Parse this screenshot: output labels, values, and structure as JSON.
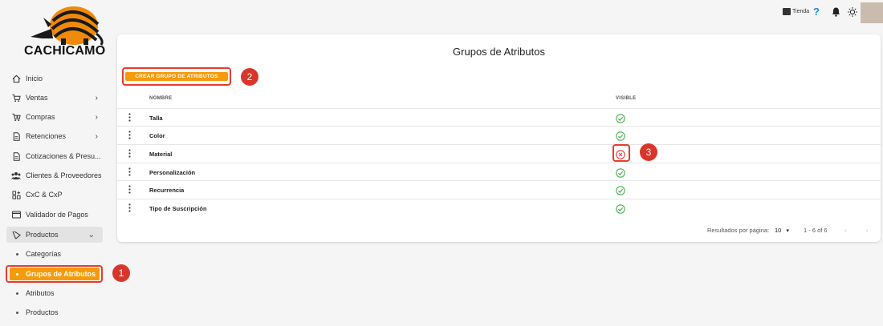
{
  "brand": {
    "name": "CACHICAMO"
  },
  "sidebar": {
    "items": [
      {
        "label": "Inicio",
        "icon": "home-icon"
      },
      {
        "label": "Ventas",
        "icon": "cart-icon"
      },
      {
        "label": "Compras",
        "icon": "cart-add-icon"
      },
      {
        "label": "Retenciones",
        "icon": "document-icon"
      },
      {
        "label": "Cotizaciones & Presu...",
        "icon": "document-icon"
      },
      {
        "label": "Clientes & Proveedores",
        "icon": "users-icon"
      },
      {
        "label": "CxC & CxP",
        "icon": "ledger-icon"
      },
      {
        "label": "Validador de Pagos",
        "icon": "card-icon"
      },
      {
        "label": "Productos",
        "icon": "products-icon"
      }
    ],
    "sub_items": [
      {
        "label": "Categorías"
      },
      {
        "label": "Grupos de Atributos"
      },
      {
        "label": "Atributos"
      },
      {
        "label": "Productos"
      }
    ]
  },
  "topbar": {
    "store_label": "Tienda",
    "help": "?"
  },
  "page": {
    "title": "Grupos de Atributos",
    "create_button": "CREAR GRUPO DE ATRIBUTOS",
    "columns": {
      "name": "NOMBRE",
      "visible": "VISIBLE"
    },
    "rows": [
      {
        "name": "Talla",
        "visible": true
      },
      {
        "name": "Color",
        "visible": true
      },
      {
        "name": "Material",
        "visible": false
      },
      {
        "name": "Personalización",
        "visible": true
      },
      {
        "name": "Recurrencia",
        "visible": true
      },
      {
        "name": "Tipo de Suscripción",
        "visible": true
      }
    ],
    "pagination": {
      "per_page_label": "Resultados por página:",
      "per_page_value": "10",
      "range": "1 - 6 of 6"
    }
  },
  "callouts": [
    "1",
    "2",
    "3"
  ],
  "colors": {
    "accent": "#f59a0b",
    "highlight": "#e63b2e",
    "ok": "#4caf50",
    "error": "#e53935"
  }
}
